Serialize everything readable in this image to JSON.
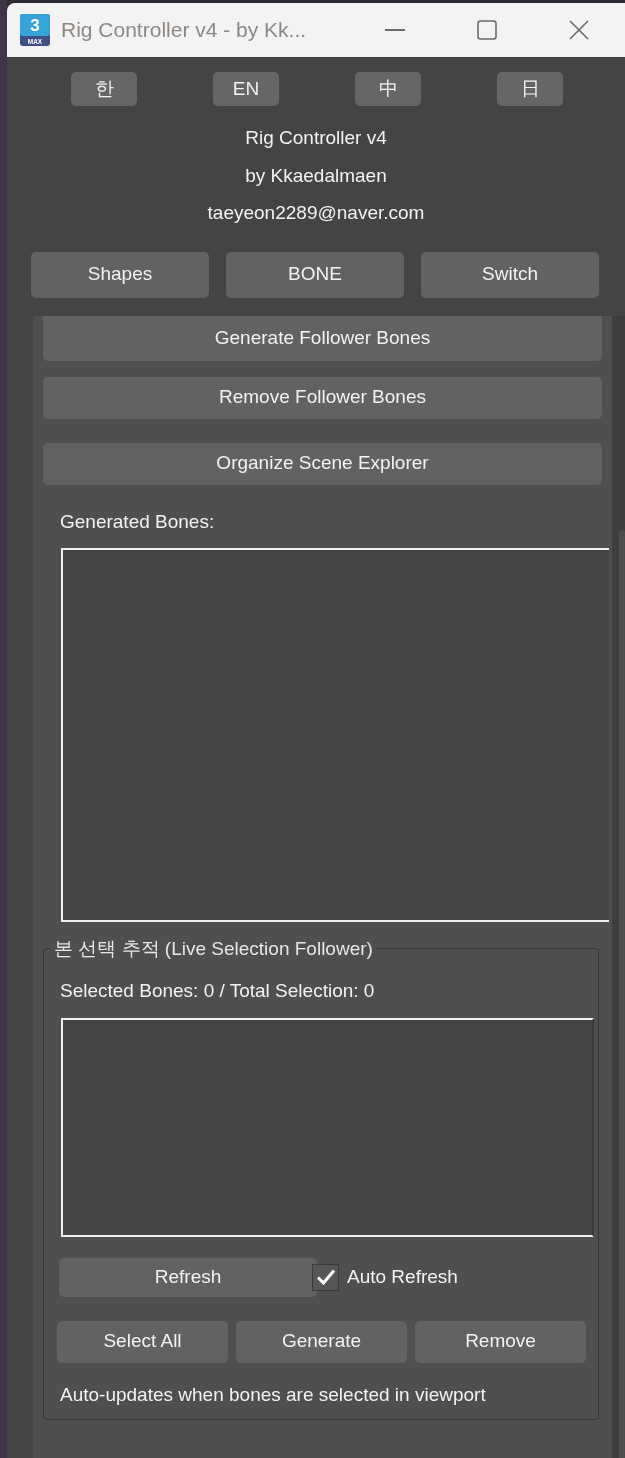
{
  "window": {
    "title": "Rig Controller v4 - by Kk...",
    "logo": {
      "number": "3",
      "caption": "MAX"
    }
  },
  "language_buttons": [
    "한",
    "EN",
    "中",
    "日"
  ],
  "credits": [
    "Rig Controller v4",
    "by Kkaedalmaen",
    "taeyeon2289@naver.com"
  ],
  "section_buttons": [
    "Shapes",
    "BONE",
    "Switch"
  ],
  "bone_panel": {
    "buttons": [
      "Generate Follower Bones",
      "Remove Follower Bones",
      "Organize Scene Explorer"
    ],
    "list_label": "Generated Bones:"
  },
  "live_selection": {
    "title": "본 선택 추적 (Live Selection Follower)",
    "status": "Selected Bones: 0 / Total Selection: 0",
    "refresh_button": "Refresh",
    "auto_refresh": {
      "label": "Auto Refresh",
      "checked": true
    },
    "buttons": [
      "Select All",
      "Generate",
      "Remove"
    ],
    "note": "Auto-updates when bones are selected in viewport"
  }
}
